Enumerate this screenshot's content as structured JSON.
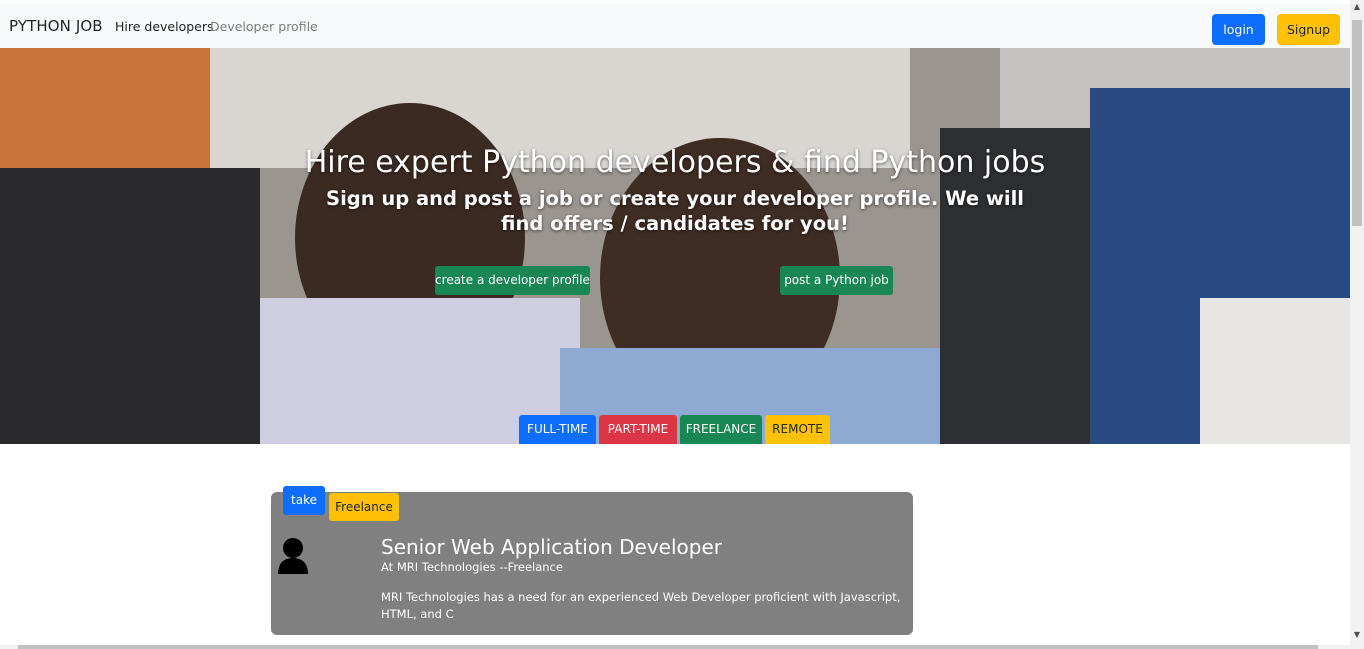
{
  "navbar": {
    "brand": "PYTHON JOB",
    "links": [
      "Hire developers",
      "Developer profile"
    ],
    "login_label": "login",
    "signup_label": "Signup"
  },
  "hero": {
    "title": "Hire expert Python developers & find Python jobs",
    "subtitle": "Sign up and post a job or create your developer profile. We will find offers / candidates for you!",
    "create_profile_label": "create a developer profile",
    "post_job_label": "post a Python job",
    "job_types": [
      "FULL-TIME",
      "PART-TIME",
      "FREELANCE",
      "REMOTE"
    ]
  },
  "job": {
    "take_label": "take",
    "type_badge": "Freelance",
    "title": "Senior Web Application Developer",
    "company_line": "At MRI Technologies --Freelance",
    "description": "MRI Technologies has a need for an experienced Web Developer proficient with Javascript, HTML, and C",
    "avatar_icon": "user-silhouette-icon"
  },
  "colors": {
    "primary": "#0d6efd",
    "warning": "#ffc107",
    "success": "#198754",
    "danger": "#dc3545",
    "card_bg": "#808080"
  }
}
